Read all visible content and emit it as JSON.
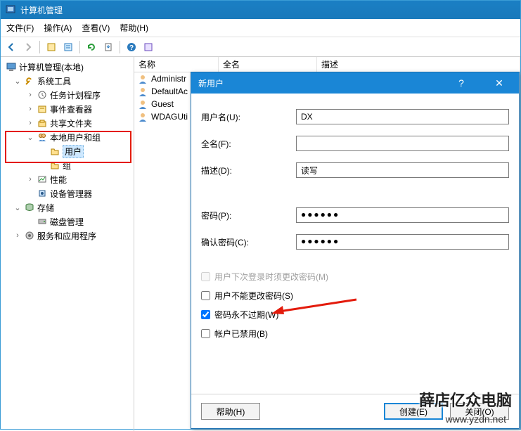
{
  "window": {
    "title": "计算机管理"
  },
  "menu": {
    "file": "文件(F)",
    "action": "操作(A)",
    "view": "查看(V)",
    "help": "帮助(H)"
  },
  "tree": {
    "root": "计算机管理(本地)",
    "systools": "系统工具",
    "task": "任务计划程序",
    "event": "事件查看器",
    "share": "共享文件夹",
    "localusers": "本地用户和组",
    "users": "用户",
    "groups": "组",
    "perf": "性能",
    "devmgr": "设备管理器",
    "storage": "存储",
    "disk": "磁盘管理",
    "services": "服务和应用程序"
  },
  "list": {
    "hdr_name": "名称",
    "hdr_full": "全名",
    "hdr_desc": "描述",
    "rows": [
      "Administr",
      "DefaultAc",
      "Guest",
      "WDAGUti"
    ]
  },
  "dialog": {
    "title": "新用户",
    "lbl_user": "用户名(U):",
    "lbl_full": "全名(F):",
    "lbl_desc": "描述(D):",
    "lbl_pw": "密码(P):",
    "lbl_pw2": "确认密码(C):",
    "val_user": "DX",
    "val_full": "",
    "val_desc": "读写",
    "val_pw": "●●●●●●",
    "val_pw2": "●●●●●●",
    "chk_mustchange": "用户下次登录时须更改密码(M)",
    "chk_cannot": "用户不能更改密码(S)",
    "chk_never": "密码永不过期(W)",
    "chk_disabled": "帐户已禁用(B)",
    "btn_help": "帮助(H)",
    "btn_create": "创建(E)",
    "btn_close": "关闭(O)"
  },
  "watermark": {
    "line1": "薛店亿众电脑",
    "line2": "www.yzdn.net"
  }
}
